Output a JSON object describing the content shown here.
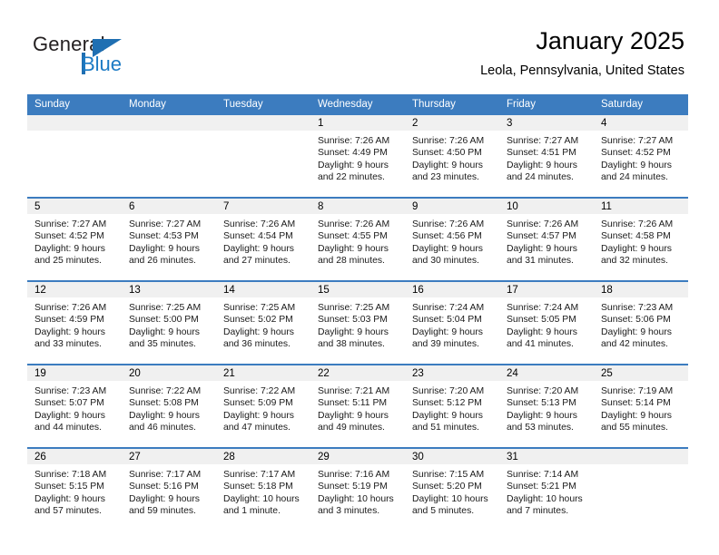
{
  "brand": {
    "word_one": "General",
    "word_two": "Blue",
    "accent_color": "#1f6fb2"
  },
  "header": {
    "title": "January 2025",
    "subtitle": "Leola, Pennsylvania, United States"
  },
  "calendar": {
    "header_bg": "#3c7cbf",
    "daynum_bg": "#f0f0f0",
    "weekday_names": [
      "Sunday",
      "Monday",
      "Tuesday",
      "Wednesday",
      "Thursday",
      "Friday",
      "Saturday"
    ],
    "weeks": [
      [
        {
          "day": "",
          "sunrise": "",
          "sunset": "",
          "daylight_1": "",
          "daylight_2": ""
        },
        {
          "day": "",
          "sunrise": "",
          "sunset": "",
          "daylight_1": "",
          "daylight_2": ""
        },
        {
          "day": "",
          "sunrise": "",
          "sunset": "",
          "daylight_1": "",
          "daylight_2": ""
        },
        {
          "day": "1",
          "sunrise": "Sunrise: 7:26 AM",
          "sunset": "Sunset: 4:49 PM",
          "daylight_1": "Daylight: 9 hours",
          "daylight_2": "and 22 minutes."
        },
        {
          "day": "2",
          "sunrise": "Sunrise: 7:26 AM",
          "sunset": "Sunset: 4:50 PM",
          "daylight_1": "Daylight: 9 hours",
          "daylight_2": "and 23 minutes."
        },
        {
          "day": "3",
          "sunrise": "Sunrise: 7:27 AM",
          "sunset": "Sunset: 4:51 PM",
          "daylight_1": "Daylight: 9 hours",
          "daylight_2": "and 24 minutes."
        },
        {
          "day": "4",
          "sunrise": "Sunrise: 7:27 AM",
          "sunset": "Sunset: 4:52 PM",
          "daylight_1": "Daylight: 9 hours",
          "daylight_2": "and 24 minutes."
        }
      ],
      [
        {
          "day": "5",
          "sunrise": "Sunrise: 7:27 AM",
          "sunset": "Sunset: 4:52 PM",
          "daylight_1": "Daylight: 9 hours",
          "daylight_2": "and 25 minutes."
        },
        {
          "day": "6",
          "sunrise": "Sunrise: 7:27 AM",
          "sunset": "Sunset: 4:53 PM",
          "daylight_1": "Daylight: 9 hours",
          "daylight_2": "and 26 minutes."
        },
        {
          "day": "7",
          "sunrise": "Sunrise: 7:26 AM",
          "sunset": "Sunset: 4:54 PM",
          "daylight_1": "Daylight: 9 hours",
          "daylight_2": "and 27 minutes."
        },
        {
          "day": "8",
          "sunrise": "Sunrise: 7:26 AM",
          "sunset": "Sunset: 4:55 PM",
          "daylight_1": "Daylight: 9 hours",
          "daylight_2": "and 28 minutes."
        },
        {
          "day": "9",
          "sunrise": "Sunrise: 7:26 AM",
          "sunset": "Sunset: 4:56 PM",
          "daylight_1": "Daylight: 9 hours",
          "daylight_2": "and 30 minutes."
        },
        {
          "day": "10",
          "sunrise": "Sunrise: 7:26 AM",
          "sunset": "Sunset: 4:57 PM",
          "daylight_1": "Daylight: 9 hours",
          "daylight_2": "and 31 minutes."
        },
        {
          "day": "11",
          "sunrise": "Sunrise: 7:26 AM",
          "sunset": "Sunset: 4:58 PM",
          "daylight_1": "Daylight: 9 hours",
          "daylight_2": "and 32 minutes."
        }
      ],
      [
        {
          "day": "12",
          "sunrise": "Sunrise: 7:26 AM",
          "sunset": "Sunset: 4:59 PM",
          "daylight_1": "Daylight: 9 hours",
          "daylight_2": "and 33 minutes."
        },
        {
          "day": "13",
          "sunrise": "Sunrise: 7:25 AM",
          "sunset": "Sunset: 5:00 PM",
          "daylight_1": "Daylight: 9 hours",
          "daylight_2": "and 35 minutes."
        },
        {
          "day": "14",
          "sunrise": "Sunrise: 7:25 AM",
          "sunset": "Sunset: 5:02 PM",
          "daylight_1": "Daylight: 9 hours",
          "daylight_2": "and 36 minutes."
        },
        {
          "day": "15",
          "sunrise": "Sunrise: 7:25 AM",
          "sunset": "Sunset: 5:03 PM",
          "daylight_1": "Daylight: 9 hours",
          "daylight_2": "and 38 minutes."
        },
        {
          "day": "16",
          "sunrise": "Sunrise: 7:24 AM",
          "sunset": "Sunset: 5:04 PM",
          "daylight_1": "Daylight: 9 hours",
          "daylight_2": "and 39 minutes."
        },
        {
          "day": "17",
          "sunrise": "Sunrise: 7:24 AM",
          "sunset": "Sunset: 5:05 PM",
          "daylight_1": "Daylight: 9 hours",
          "daylight_2": "and 41 minutes."
        },
        {
          "day": "18",
          "sunrise": "Sunrise: 7:23 AM",
          "sunset": "Sunset: 5:06 PM",
          "daylight_1": "Daylight: 9 hours",
          "daylight_2": "and 42 minutes."
        }
      ],
      [
        {
          "day": "19",
          "sunrise": "Sunrise: 7:23 AM",
          "sunset": "Sunset: 5:07 PM",
          "daylight_1": "Daylight: 9 hours",
          "daylight_2": "and 44 minutes."
        },
        {
          "day": "20",
          "sunrise": "Sunrise: 7:22 AM",
          "sunset": "Sunset: 5:08 PM",
          "daylight_1": "Daylight: 9 hours",
          "daylight_2": "and 46 minutes."
        },
        {
          "day": "21",
          "sunrise": "Sunrise: 7:22 AM",
          "sunset": "Sunset: 5:09 PM",
          "daylight_1": "Daylight: 9 hours",
          "daylight_2": "and 47 minutes."
        },
        {
          "day": "22",
          "sunrise": "Sunrise: 7:21 AM",
          "sunset": "Sunset: 5:11 PM",
          "daylight_1": "Daylight: 9 hours",
          "daylight_2": "and 49 minutes."
        },
        {
          "day": "23",
          "sunrise": "Sunrise: 7:20 AM",
          "sunset": "Sunset: 5:12 PM",
          "daylight_1": "Daylight: 9 hours",
          "daylight_2": "and 51 minutes."
        },
        {
          "day": "24",
          "sunrise": "Sunrise: 7:20 AM",
          "sunset": "Sunset: 5:13 PM",
          "daylight_1": "Daylight: 9 hours",
          "daylight_2": "and 53 minutes."
        },
        {
          "day": "25",
          "sunrise": "Sunrise: 7:19 AM",
          "sunset": "Sunset: 5:14 PM",
          "daylight_1": "Daylight: 9 hours",
          "daylight_2": "and 55 minutes."
        }
      ],
      [
        {
          "day": "26",
          "sunrise": "Sunrise: 7:18 AM",
          "sunset": "Sunset: 5:15 PM",
          "daylight_1": "Daylight: 9 hours",
          "daylight_2": "and 57 minutes."
        },
        {
          "day": "27",
          "sunrise": "Sunrise: 7:17 AM",
          "sunset": "Sunset: 5:16 PM",
          "daylight_1": "Daylight: 9 hours",
          "daylight_2": "and 59 minutes."
        },
        {
          "day": "28",
          "sunrise": "Sunrise: 7:17 AM",
          "sunset": "Sunset: 5:18 PM",
          "daylight_1": "Daylight: 10 hours",
          "daylight_2": "and 1 minute."
        },
        {
          "day": "29",
          "sunrise": "Sunrise: 7:16 AM",
          "sunset": "Sunset: 5:19 PM",
          "daylight_1": "Daylight: 10 hours",
          "daylight_2": "and 3 minutes."
        },
        {
          "day": "30",
          "sunrise": "Sunrise: 7:15 AM",
          "sunset": "Sunset: 5:20 PM",
          "daylight_1": "Daylight: 10 hours",
          "daylight_2": "and 5 minutes."
        },
        {
          "day": "31",
          "sunrise": "Sunrise: 7:14 AM",
          "sunset": "Sunset: 5:21 PM",
          "daylight_1": "Daylight: 10 hours",
          "daylight_2": "and 7 minutes."
        },
        {
          "day": "",
          "sunrise": "",
          "sunset": "",
          "daylight_1": "",
          "daylight_2": ""
        }
      ]
    ]
  }
}
